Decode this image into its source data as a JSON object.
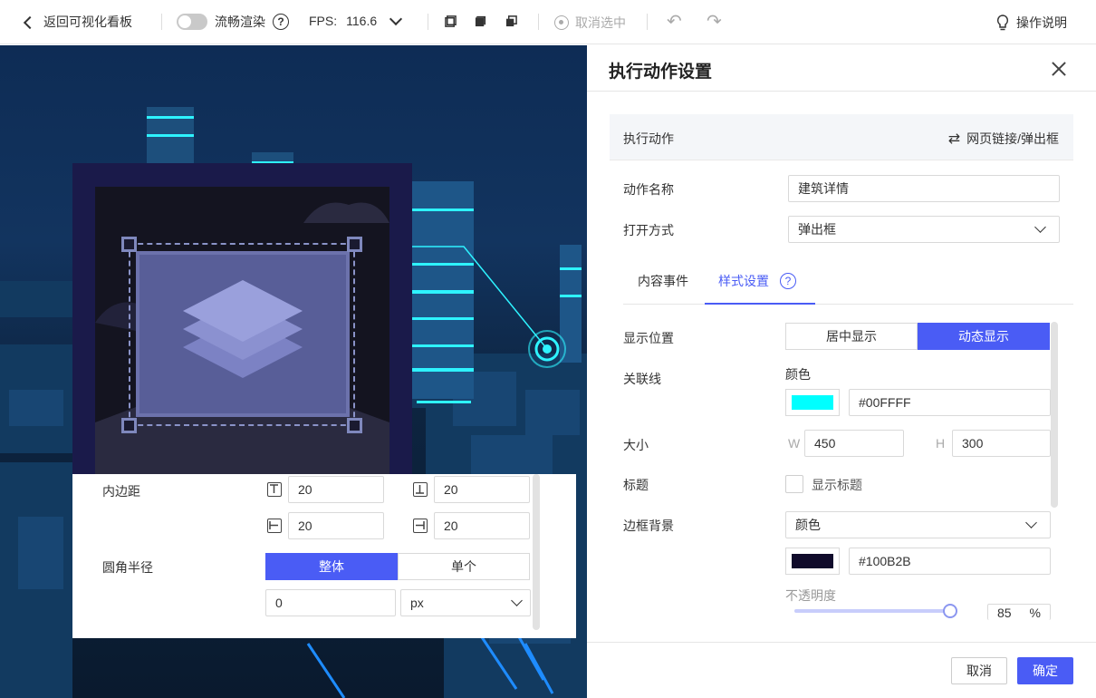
{
  "toolbar": {
    "back_label": "返回可视化看板",
    "smooth_render_label": "流畅渲染",
    "help_mark": "?",
    "fps_label": "FPS:",
    "fps_value": "116.6",
    "deselect_label": "取消选中",
    "undo_glyph": "↶",
    "redo_glyph": "↷",
    "guide_label": "操作说明"
  },
  "colors": {
    "accent": "#4a5cf5",
    "link_line": "#00FFFF",
    "border_bg": "#100B2B"
  },
  "icons": [
    "chevron-left-icon",
    "help-circle-icon",
    "chevron-down-icon",
    "cube-icon",
    "deselect-icon",
    "undo-icon",
    "redo-icon",
    "lightbulb-icon",
    "close-icon",
    "swap-icon",
    "layers-icon"
  ],
  "scene_panel": {
    "padding_label": "内边距",
    "padding_top": "20",
    "padding_bottom": "20",
    "padding_left": "20",
    "padding_right": "20",
    "radius_label": "圆角半径",
    "radius_modes": [
      "整体",
      "单个"
    ],
    "radius_value": "0",
    "radius_unit": "px"
  },
  "dialog": {
    "title": "执行动作设置",
    "action_label": "执行动作",
    "action_type": "网页链接/弹出框",
    "action_name_label": "动作名称",
    "action_name_value": "建筑详情",
    "open_mode_label": "打开方式",
    "open_mode_value": "弹出框",
    "tabs": [
      "内容事件",
      "样式设置"
    ],
    "tab_help": "?",
    "display_pos_label": "显示位置",
    "display_pos_options": [
      "居中显示",
      "动态显示"
    ],
    "link_line_label": "关联线",
    "color_label": "颜色",
    "link_color_hex": "#00FFFF",
    "size_label": "大小",
    "w_prefix": "W",
    "w_value": "450",
    "h_prefix": "H",
    "h_value": "300",
    "title_label": "标题",
    "show_title_label": "显示标题",
    "border_bg_label": "边框背景",
    "border_bg_mode": "颜色",
    "border_bg_hex": "#100B2B",
    "opacity_label": "不透明度",
    "opacity_value": "85",
    "opacity_unit": "%",
    "cancel_label": "取消",
    "ok_label": "确定"
  }
}
